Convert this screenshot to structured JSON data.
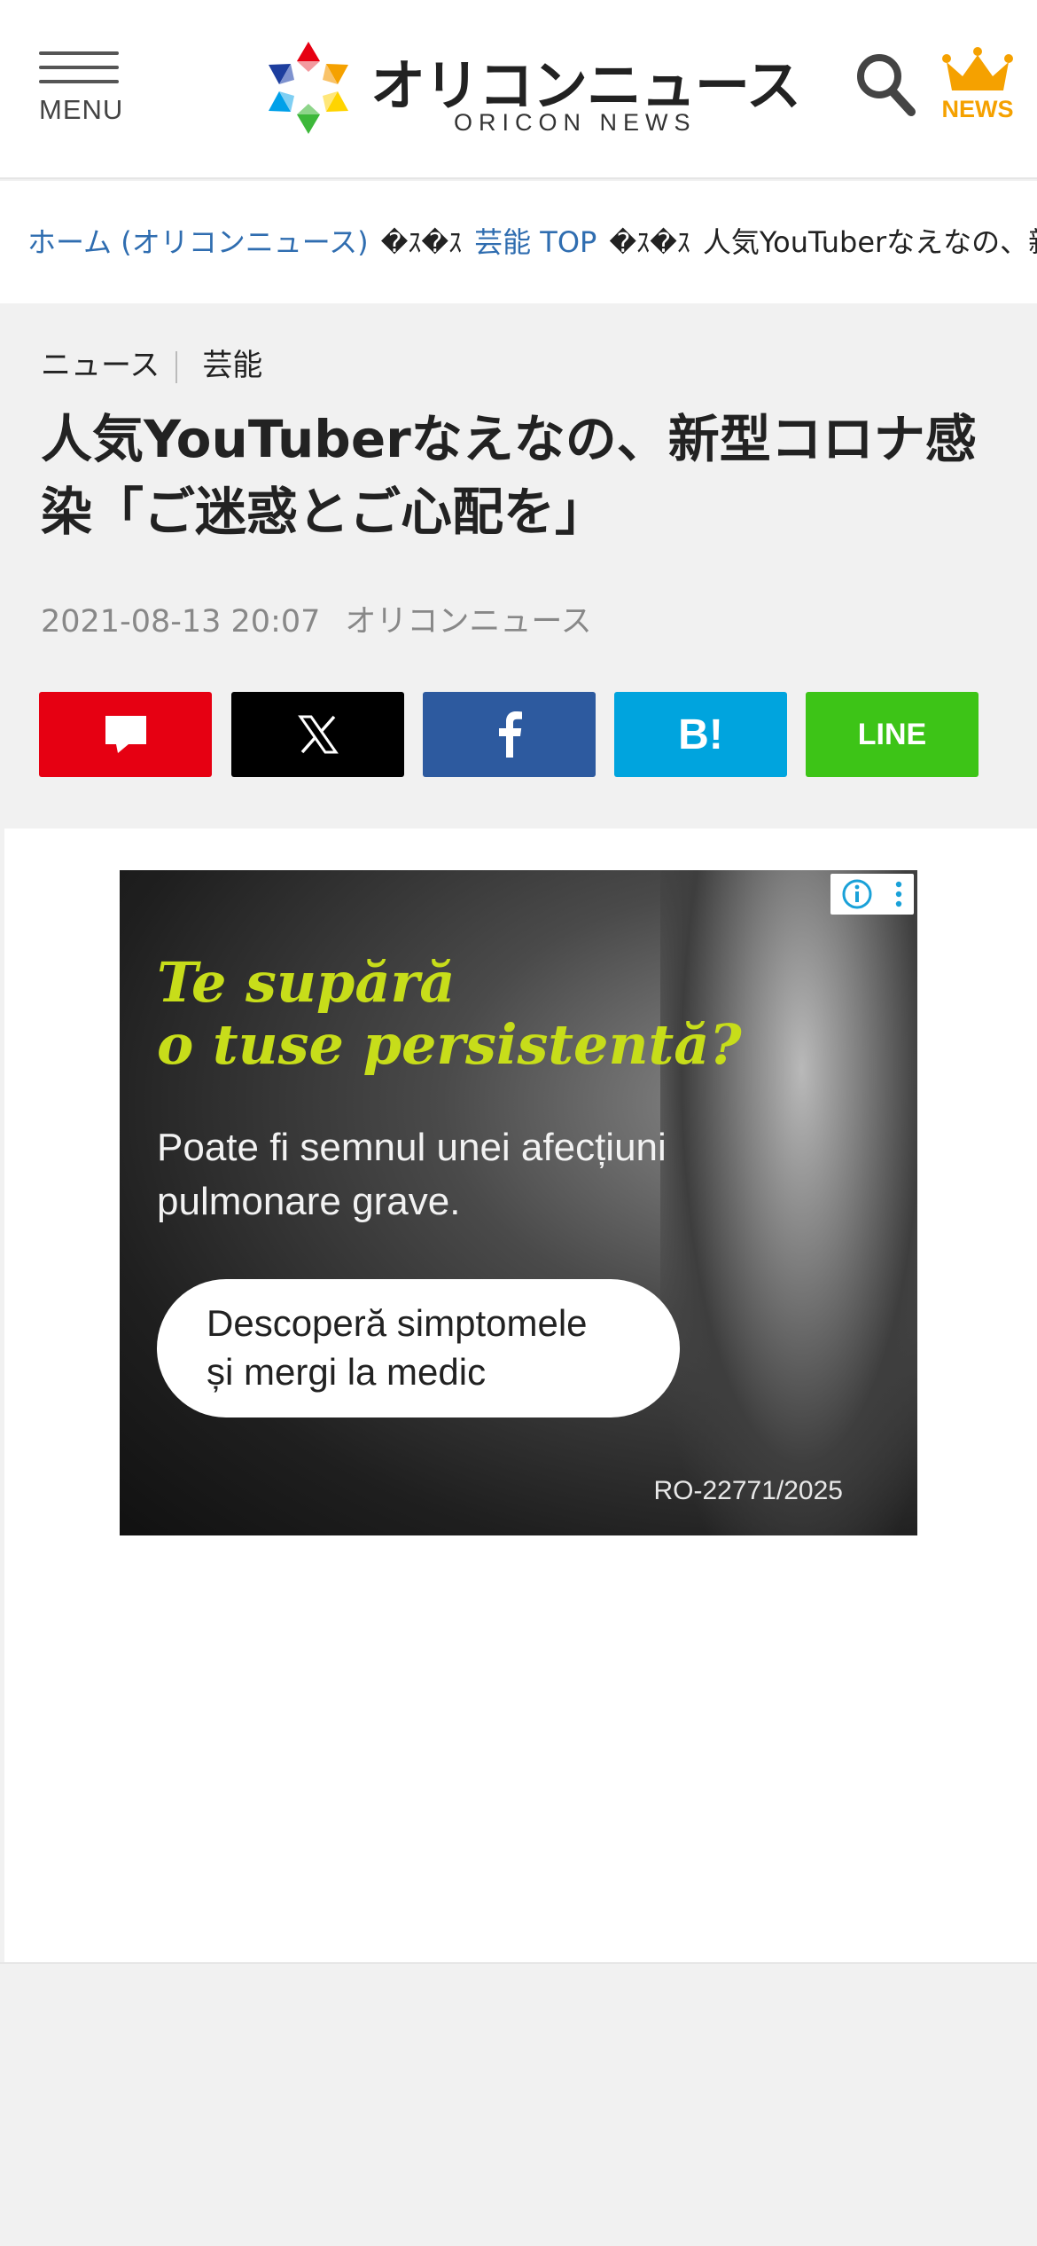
{
  "header": {
    "menu_label": "MENU",
    "logo_text_jp": "オリコンニュース",
    "logo_text_en": "ORICON NEWS",
    "news_label": "NEWS"
  },
  "breadcrumb": {
    "home": "ホーム (オリコンニュース)",
    "separator": "�ｽ�ｽ",
    "category": "芸能 TOP",
    "current": "人気YouTuberなえなの、新型コロナ感染「ご迷惑とご心配を」"
  },
  "article": {
    "category_primary": "ニュース",
    "category_secondary": "芸能",
    "title": "人気YouTuberなえなの、新型コロナ感染「ご迷惑とご心配を」",
    "date": "2021-08-13 20:07",
    "source": "オリコンニュース"
  },
  "share": {
    "hatena_label": "B!",
    "line_label": "LINE"
  },
  "ad": {
    "headline_line1": "Te supără",
    "headline_line2": "o tuse persistentă?",
    "body": "Poate fi semnul unei afecțiuni pulmonare grave.",
    "cta_line1": "Descoperă simptomele",
    "cta_line2": "și mergi la medic",
    "code": "RO-22771/2025"
  },
  "colors": {
    "link": "#2f6db0",
    "news_gold": "#f5a100",
    "comment_red": "#e60012",
    "facebook_blue": "#2d5a9f",
    "hatena_blue": "#00a4de",
    "line_green": "#3dc417",
    "ad_lime": "#c7dd1a"
  }
}
